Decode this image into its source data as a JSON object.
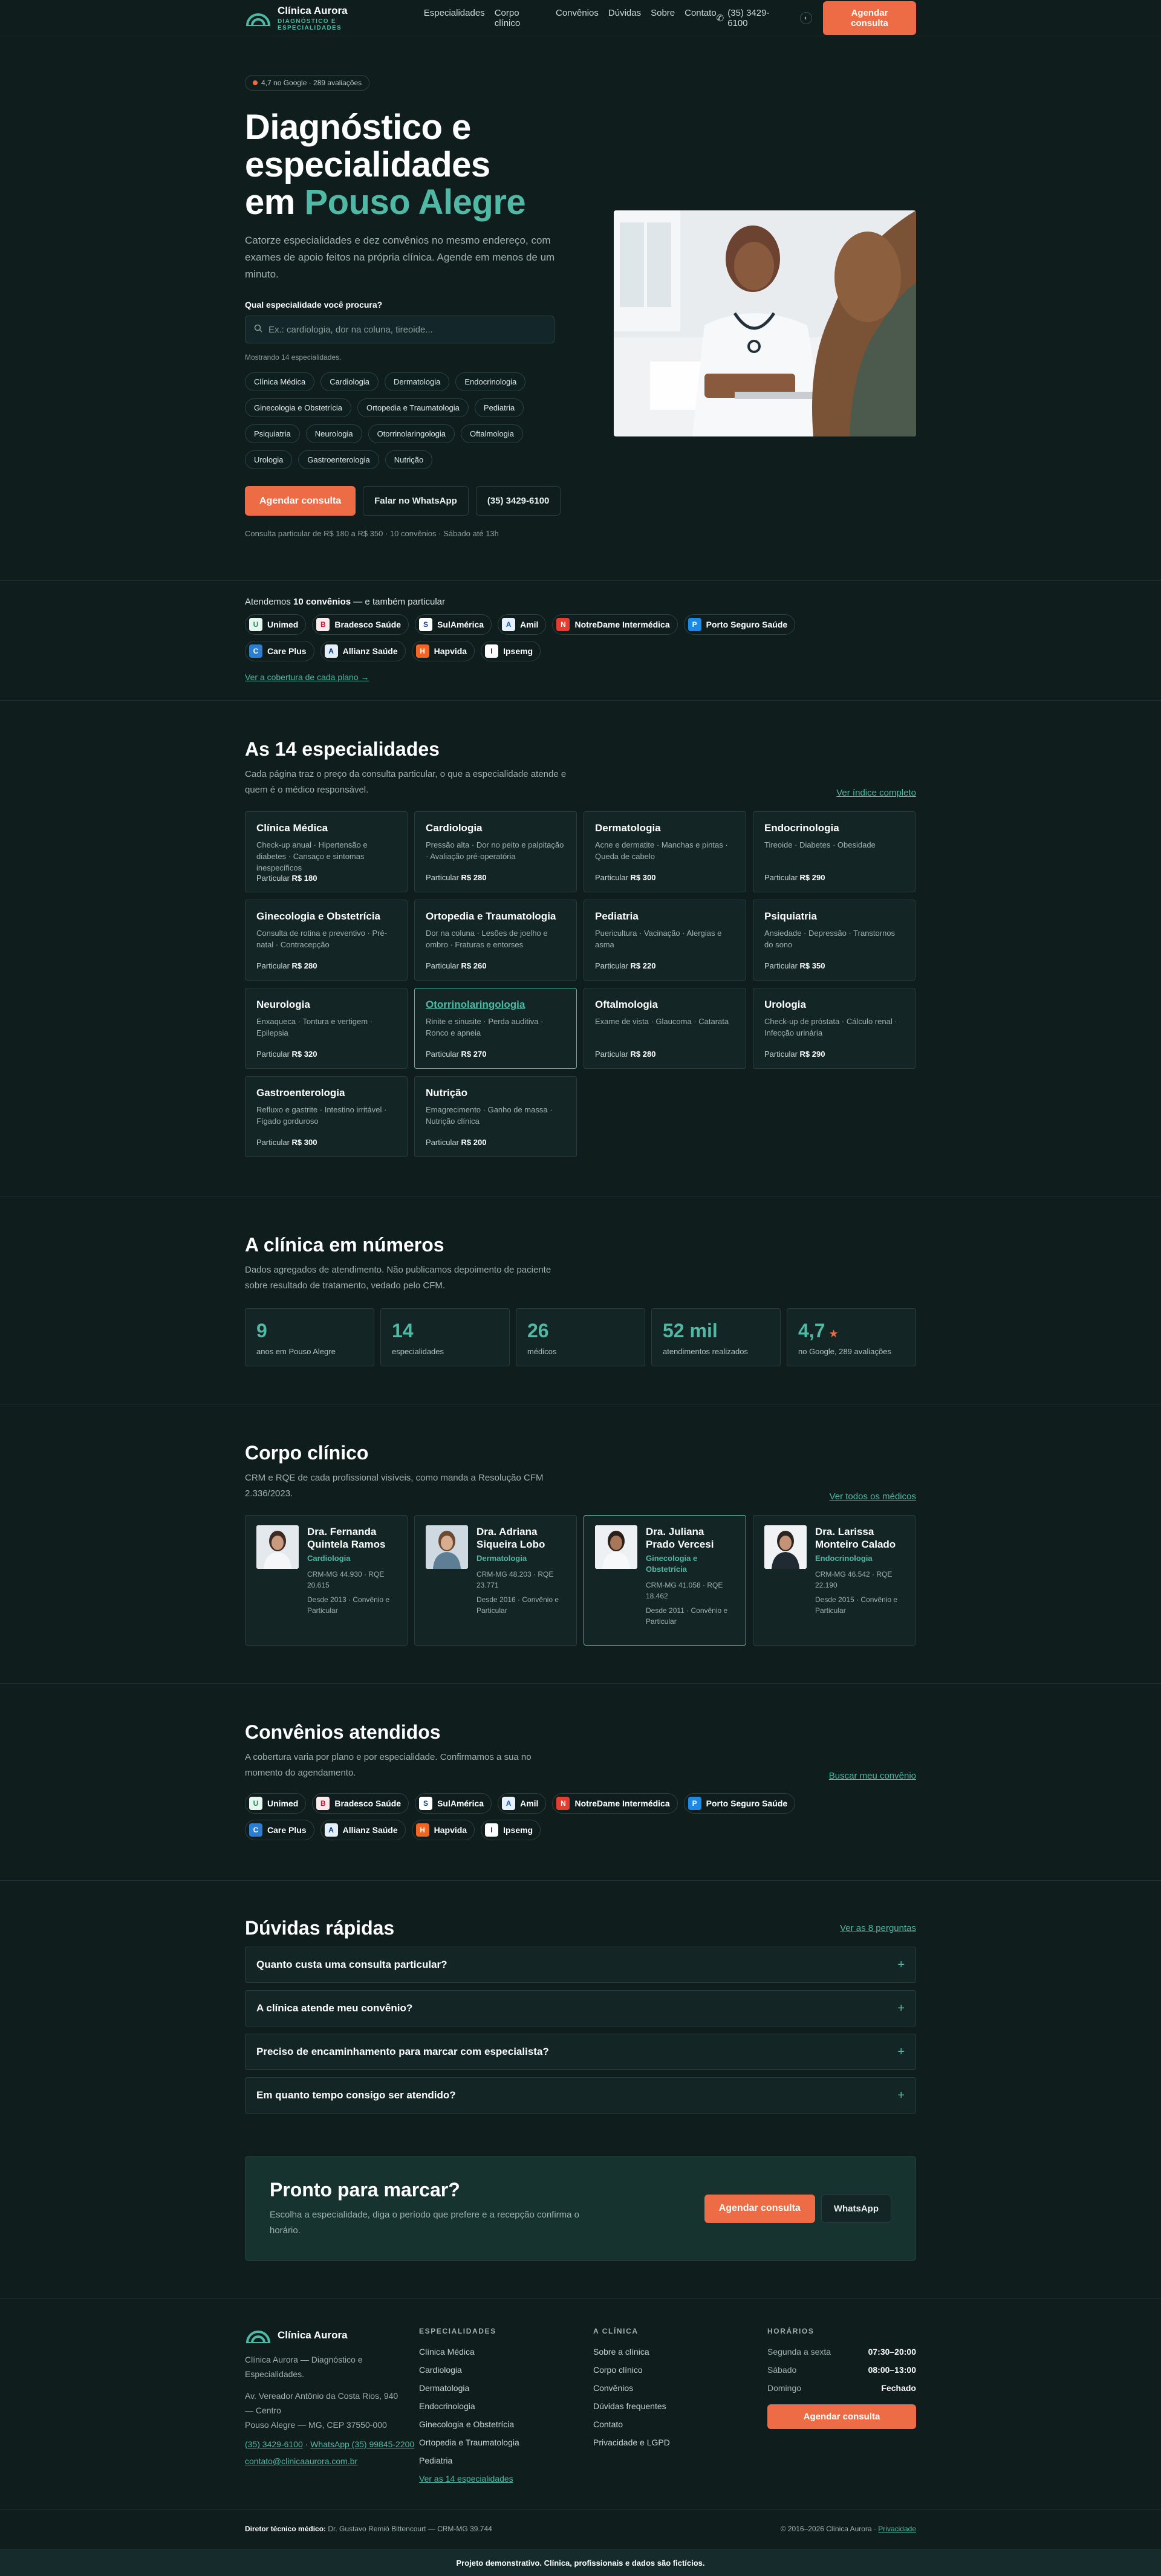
{
  "brand": {
    "name": "Clínica Aurora",
    "tagline": "DIAGNÓSTICO E ESPECIALIDADES"
  },
  "nav": {
    "links": [
      "Especialidades",
      "Corpo clínico",
      "Convênios",
      "Dúvidas",
      "Sobre",
      "Contato"
    ],
    "phone": "(35) 3429-6100",
    "cta": "Agendar consulta"
  },
  "hero": {
    "rating": "4,7 no Google · 289 avaliações",
    "title_line1": "Diagnóstico e",
    "title_line2": "especialidades",
    "title_line3_a": "em ",
    "title_line3_b": "Pouso Alegre",
    "subtitle": "Catorze especialidades e dez convênios no mesmo endereço, com exames de apoio feitos na própria clínica. Agende em menos de um minuto.",
    "search_label": "Qual especialidade você procura?",
    "search_placeholder": "Ex.: cardiologia, dor na coluna, tireoide...",
    "count_note": "Mostrando 14 especialidades.",
    "chips": [
      "Clínica Médica",
      "Cardiologia",
      "Dermatologia",
      "Endocrinologia",
      "Ginecologia e Obstetrícia",
      "Ortopedia e Traumatologia",
      "Pediatria",
      "Psiquiatria",
      "Neurologia",
      "Otorrinolaringologia",
      "Oftalmologia",
      "Urologia",
      "Gastroenterologia",
      "Nutrição"
    ],
    "btn_primary": "Agendar consulta",
    "btn_whatsapp": "Falar no WhatsApp",
    "btn_phone": "(35) 3429-6100",
    "note": "Consulta particular de R$ 180 a R$ 350 · 10 convênios · Sábado até 13h"
  },
  "insurers_strip": {
    "title_a": "Atendemos ",
    "title_b": "10 convênios",
    "title_c": " — e também particular",
    "link": "Ver a cobertura de cada plano →"
  },
  "insurers": [
    {
      "name": "Unimed",
      "icon": "U",
      "color": "#1f8a5b",
      "bg": "#e8f5ee"
    },
    {
      "name": "Bradesco Saúde",
      "icon": "B",
      "color": "#c8102e",
      "bg": "#fde8eb"
    },
    {
      "name": "SulAmérica",
      "icon": "S",
      "color": "#0a3d91",
      "bg": "#ffffff"
    },
    {
      "name": "Amil",
      "icon": "A",
      "color": "#1a5fb4",
      "bg": "#e7f0fb"
    },
    {
      "name": "NotreDame Intermédica",
      "icon": "N",
      "color": "#ffffff",
      "bg": "#e53d2f"
    },
    {
      "name": "Porto Seguro Saúde",
      "icon": "P",
      "color": "#ffffff",
      "bg": "#1e88e5"
    },
    {
      "name": "Care Plus",
      "icon": "C",
      "color": "#ffffff",
      "bg": "#2a7fd4"
    },
    {
      "name": "Allianz Saúde",
      "icon": "A",
      "color": "#003781",
      "bg": "#e6eef9"
    },
    {
      "name": "Hapvida",
      "icon": "H",
      "color": "#ffffff",
      "bg": "#f26522"
    },
    {
      "name": "Ipsemg",
      "icon": "I",
      "color": "#1b1b1b",
      "bg": "#ffffff"
    }
  ],
  "specialties": {
    "title": "As 14 especialidades",
    "subtitle": "Cada página traz o preço da consulta particular, o que a especialidade atende e quem é o médico responsável.",
    "link": "Ver índice completo",
    "price_prefix": "Particular ",
    "items": [
      {
        "name": "Clínica Médica",
        "desc": "Check-up anual · Hipertensão e diabetes · Cansaço e sintomas inespecíficos",
        "price": "R$ 180"
      },
      {
        "name": "Cardiologia",
        "desc": "Pressão alta · Dor no peito e palpitação · Avaliação pré-operatória",
        "price": "R$ 280"
      },
      {
        "name": "Dermatologia",
        "desc": "Acne e dermatite · Manchas e pintas · Queda de cabelo",
        "price": "R$ 300"
      },
      {
        "name": "Endocrinologia",
        "desc": "Tireoide · Diabetes · Obesidade",
        "price": "R$ 290"
      },
      {
        "name": "Ginecologia e Obstetrícia",
        "desc": "Consulta de rotina e preventivo · Pré-natal · Contracepção",
        "price": "R$ 280"
      },
      {
        "name": "Ortopedia e Traumatologia",
        "desc": "Dor na coluna · Lesões de joelho e ombro · Fraturas e entorses",
        "price": "R$ 260"
      },
      {
        "name": "Pediatria",
        "desc": "Puericultura · Vacinação · Alergias e asma",
        "price": "R$ 220"
      },
      {
        "name": "Psiquiatria",
        "desc": "Ansiedade · Depressão · Transtornos do sono",
        "price": "R$ 350"
      },
      {
        "name": "Neurologia",
        "desc": "Enxaqueca · Tontura e vertigem · Epilepsia",
        "price": "R$ 320"
      },
      {
        "name": "Otorrinolaringologia",
        "desc": "Rinite e sinusite · Perda auditiva · Ronco e apneia",
        "price": "R$ 270"
      },
      {
        "name": "Oftalmologia",
        "desc": "Exame de vista · Glaucoma · Catarata",
        "price": "R$ 280"
      },
      {
        "name": "Urologia",
        "desc": "Check-up de próstata · Cálculo renal · Infecção urinária",
        "price": "R$ 290"
      },
      {
        "name": "Gastroenterologia",
        "desc": "Refluxo e gastrite · Intestino irritável · Fígado gorduroso",
        "price": "R$ 300"
      },
      {
        "name": "Nutrição",
        "desc": "Emagrecimento · Ganho de massa · Nutrição clínica",
        "price": "R$ 200"
      }
    ]
  },
  "numbers": {
    "title": "A clínica em números",
    "subtitle": "Dados agregados de atendimento. Não publicamos depoimento de paciente sobre resultado de tratamento, vedado pelo CFM.",
    "items": [
      {
        "value": "9",
        "label": "anos em Pouso Alegre"
      },
      {
        "value": "14",
        "label": "especialidades"
      },
      {
        "value": "26",
        "label": "médicos"
      },
      {
        "value": "52 mil",
        "label": "atendimentos realizados"
      },
      {
        "value": "4,7",
        "star": "★",
        "label": "no Google, 289 avaliações"
      }
    ]
  },
  "doctors": {
    "title": "Corpo clínico",
    "subtitle": "CRM e RQE de cada profissional visíveis, como manda a Resolução CFM 2.336/2023.",
    "link": "Ver todos os médicos",
    "items": [
      {
        "name": "Dra. Fernanda Quintela Ramos",
        "spec": "Cardiologia",
        "crm": "CRM-MG 44.930 · RQE 20.615",
        "since": "Desde 2013 · Convênio e Particular"
      },
      {
        "name": "Dra. Adriana Siqueira Lobo",
        "spec": "Dermatologia",
        "crm": "CRM-MG 48.203 · RQE 23.771",
        "since": "Desde 2016 · Convênio e Particular"
      },
      {
        "name": "Dra. Juliana Prado Vercesi",
        "spec": "Ginecologia e Obstetrícia",
        "crm": "CRM-MG 41.058 · RQE 18.462",
        "since": "Desde 2011 · Convênio e Particular"
      },
      {
        "name": "Dra. Larissa Monteiro Calado",
        "spec": "Endocrinologia",
        "crm": "CRM-MG 46.542 · RQE 22.190",
        "since": "Desde 2015 · Convênio e Particular"
      }
    ]
  },
  "convenios": {
    "title": "Convênios atendidos",
    "subtitle": "A cobertura varia por plano e por especialidade. Confirmamos a sua no momento do agendamento.",
    "link": "Buscar meu convênio"
  },
  "faq": {
    "title": "Dúvidas rápidas",
    "link": "Ver as 8 perguntas",
    "items": [
      "Quanto custa uma consulta particular?",
      "A clínica atende meu convênio?",
      "Preciso de encaminhamento para marcar com especialista?",
      "Em quanto tempo consigo ser atendido?"
    ]
  },
  "cta": {
    "title": "Pronto para marcar?",
    "text": "Escolha a especialidade, diga o período que prefere e a recepção confirma o horário.",
    "btn_primary": "Agendar consulta",
    "btn_secondary": "WhatsApp"
  },
  "footer": {
    "brand": "Clínica Aurora",
    "desc": "Clínica Aurora — Diagnóstico e Especialidades.",
    "addr1": "Av. Vereador Antônio da Costa Rios, 940",
    "addr2": "— Centro",
    "addr3": "Pouso Alegre — MG, CEP 37550-000",
    "phone": "(35) 3429-6100",
    "sep": " · ",
    "whatsapp": "WhatsApp (35) 99845-2200",
    "email": "contato@clinicaaurora.com.br",
    "spec_h": "ESPECIALIDADES",
    "spec_links": [
      "Clínica Médica",
      "Cardiologia",
      "Dermatologia",
      "Endocrinologia",
      "Ginecologia e Obstetrícia",
      "Ortopedia e Traumatologia",
      "Pediatria"
    ],
    "spec_all": "Ver as 14 especialidades",
    "clinic_h": "A CLÍNICA",
    "clinic_links": [
      "Sobre a clínica",
      "Corpo clínico",
      "Convênios",
      "Dúvidas frequentes",
      "Contato",
      "Privacidade e LGPD"
    ],
    "hours_h": "HORÁRIOS",
    "hours": [
      {
        "day": "Segunda a sexta",
        "time": "07:30–20:00"
      },
      {
        "day": "Sábado",
        "time": "08:00–13:00"
      },
      {
        "day": "Domingo",
        "time": "Fechado"
      }
    ],
    "cta": "Agendar consulta",
    "director_label": "Diretor técnico médico:",
    "director": " Dr. Gustavo Remió Bittencourt — CRM-MG 39.744",
    "copyright": "© 2016–2026 Clínica Aurora · ",
    "privacy": "Privacidade",
    "demo": "Projeto demonstrativo. Clínica, profissionais e dados são fictícios."
  }
}
